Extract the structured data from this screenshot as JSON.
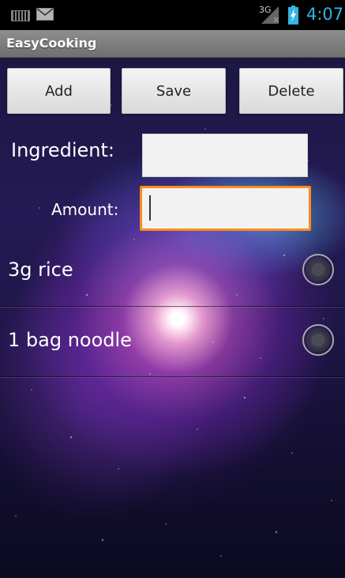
{
  "status_bar": {
    "network_label": "3G",
    "time": "4:07",
    "icons": [
      "keyboard-icon",
      "mail-icon",
      "signal-icon",
      "battery-charging-icon"
    ],
    "time_color": "#33b5e5"
  },
  "app": {
    "title": "EasyCooking"
  },
  "toolbar": {
    "add_label": "Add",
    "save_label": "Save",
    "delete_label": "Delete"
  },
  "form": {
    "ingredient_label": "Ingredient:",
    "ingredient_value": "",
    "amount_label": "Amount:",
    "amount_value": "",
    "focus_color": "#ff8c1a"
  },
  "list": {
    "items": [
      {
        "label": "3g rice",
        "checked": false
      },
      {
        "label": "1 bag noodle",
        "checked": false
      }
    ]
  }
}
